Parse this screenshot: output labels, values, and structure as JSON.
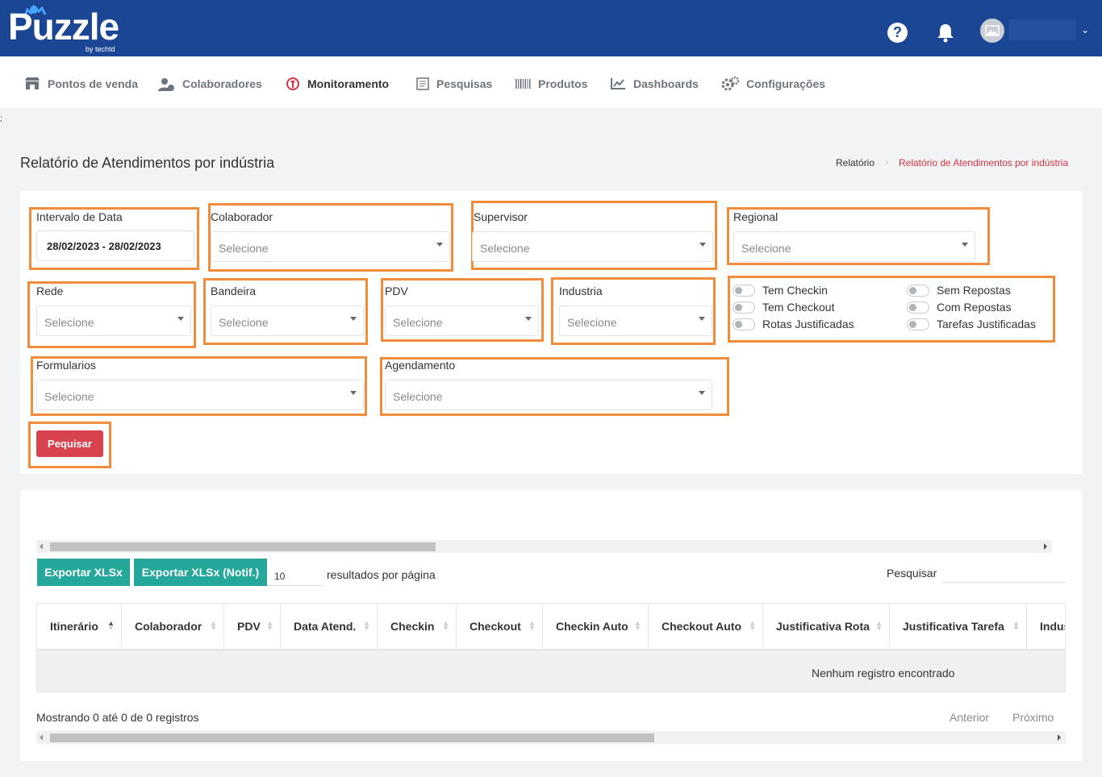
{
  "app": {
    "logo_text": "Puzzle",
    "logo_sub": "by techtd"
  },
  "menu": {
    "items": [
      {
        "label": "Pontos de venda"
      },
      {
        "label": "Colaboradores"
      },
      {
        "label": "Monitoramento"
      },
      {
        "label": "Pesquisas"
      },
      {
        "label": "Produtos"
      },
      {
        "label": "Dashboards"
      },
      {
        "label": "Configurações"
      }
    ],
    "active": "Monitoramento"
  },
  "stray_char": ";",
  "page": {
    "title": "Relatório de Atendimentos por indústria",
    "breadcrumb": [
      "Relatório",
      "Relatório de Atendimentos por indústria"
    ]
  },
  "filters": {
    "date": {
      "label": "Intervalo de Data",
      "value": "28/02/2023 - 28/02/2023"
    },
    "colaborador": {
      "label": "Colaborador",
      "placeholder": "Selecione"
    },
    "supervisor": {
      "label": "Supervisor",
      "placeholder": "Selecione"
    },
    "regional": {
      "label": "Regional",
      "placeholder": "Selecione"
    },
    "rede": {
      "label": "Rede",
      "placeholder": "Selecione"
    },
    "bandeira": {
      "label": "Bandeira",
      "placeholder": "Selecione"
    },
    "pdv": {
      "label": "PDV",
      "placeholder": "Selecione"
    },
    "industria": {
      "label": "Industria",
      "placeholder": "Selecione"
    },
    "formularios": {
      "label": "Formularios",
      "placeholder": "Selecione"
    },
    "agendamento": {
      "label": "Agendamento",
      "placeholder": "Selecione"
    },
    "toggles": [
      {
        "label": "Tem Checkin"
      },
      {
        "label": "Tem Checkout"
      },
      {
        "label": "Rotas Justificadas"
      },
      {
        "label": "Sem Repostas"
      },
      {
        "label": "Com Repostas"
      },
      {
        "label": "Tarefas Justificadas"
      }
    ],
    "search_button": "Pequisar"
  },
  "results": {
    "export_xlsx": "Exportar XLSx",
    "export_xlsx_notif": "Exportar XLSx (Notif.)",
    "page_length": "10",
    "page_length_text": "resultados por página",
    "search_label": "Pesquisar",
    "columns": [
      "Itinerário",
      "Colaborador",
      "PDV",
      "Data Atend.",
      "Checkin",
      "Checkout",
      "Checkin Auto",
      "Checkout Auto",
      "Justificativa Rota",
      "Justificativa Tarefa",
      "Indus"
    ],
    "empty_message": "Nenhum registro encontrado",
    "info": "Mostrando 0 até 0 de 0 registros",
    "prev": "Anterior",
    "next": "Próximo"
  },
  "colors": {
    "topbar": "#1b4694",
    "accent_red": "#d9424f",
    "teal": "#25a89b",
    "highlight": "#f08c3a"
  }
}
